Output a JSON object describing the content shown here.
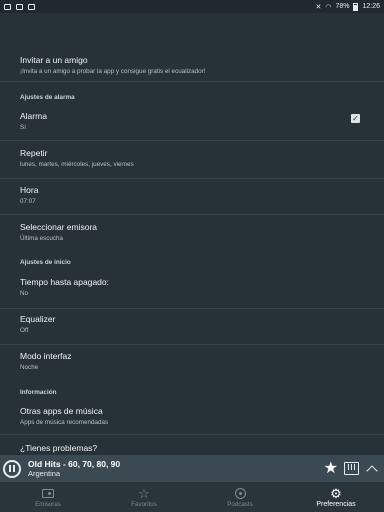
{
  "status_bar": {
    "battery": "78%",
    "time": "12:26"
  },
  "settings": {
    "invite": {
      "title": "Invitar a un amigo",
      "subtitle": "¡Invita a un amigo a probar la app y consigue gratis el ecualizador!"
    },
    "alarm_section": "Ajustes de alarma",
    "alarm": {
      "title": "Alarma",
      "subtitle": "Sí",
      "checked": true
    },
    "repeat": {
      "title": "Repetir",
      "subtitle": "lunes, martes, miércoles, jueves, viernes"
    },
    "hour": {
      "title": "Hora",
      "subtitle": "07:07"
    },
    "station": {
      "title": "Seleccionar emisora",
      "subtitle": "Última escucha"
    },
    "start_section": "Ajustes de inicio",
    "sleep_timer": {
      "title": "Tiempo hasta apagado:",
      "subtitle": "No"
    },
    "equalizer": {
      "title": "Equalizer",
      "subtitle": "Off"
    },
    "interface_mode": {
      "title": "Modo interfaz",
      "subtitle": "Noche"
    },
    "info_section": "Información",
    "other_apps": {
      "title": "Otras apps de música",
      "subtitle": "Apps de música recomendadas"
    },
    "problems": {
      "title": "¿Tienes problemas?"
    }
  },
  "player": {
    "station_name": "Old Hits - 60, 70, 80, 90",
    "country": "Argentina"
  },
  "bottom_nav": {
    "items": [
      {
        "label": "Emisoras",
        "icon": "radio-icon"
      },
      {
        "label": "Favoritos",
        "icon": "star-icon"
      },
      {
        "label": "Podcasts",
        "icon": "podcast-icon"
      },
      {
        "label": "Preferencias",
        "icon": "gear-icon",
        "active": true
      }
    ]
  },
  "colors": {
    "background": "#263238",
    "player_bar": "#3b4a52",
    "bottom_nav": "#2a353b"
  }
}
